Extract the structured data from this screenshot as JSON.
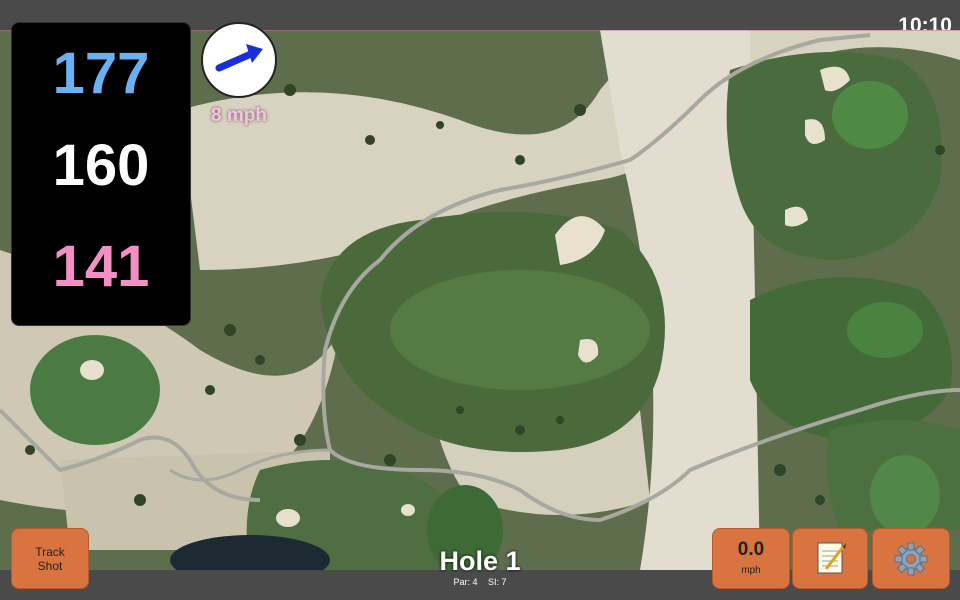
{
  "status_bar": {
    "time": "10:10"
  },
  "distances": {
    "back": "177",
    "middle": "160",
    "front": "141"
  },
  "wind": {
    "speed": "8 mph",
    "direction": "east-northeast",
    "arrow_icon": "wind-arrow-icon"
  },
  "hole": {
    "title": "Hole 1",
    "par": "Par: 4",
    "stroke_index": "SI: 7"
  },
  "buttons": {
    "track_shot": {
      "line1": "Track",
      "line2": "Shot"
    },
    "speed": {
      "value": "0.0",
      "unit": "mph"
    },
    "notes": {
      "icon": "notepad-icon"
    },
    "settings": {
      "icon": "gear-icon"
    }
  },
  "colors": {
    "back_distance": "#6ab0f3",
    "middle_distance": "#ffffff",
    "front_distance": "#f48fc5",
    "button_bg": "#d9733f",
    "wind_text": "#f9c2e3",
    "wind_arrow": "#1a2fd6"
  }
}
